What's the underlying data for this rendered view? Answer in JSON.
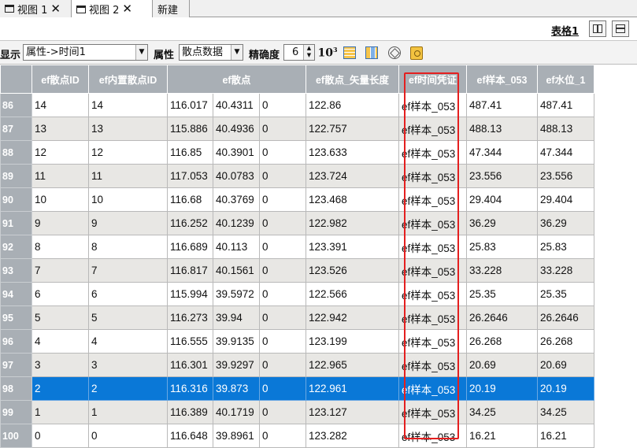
{
  "tabs": [
    {
      "label": "视图 1",
      "active": false
    },
    {
      "label": "视图 2",
      "active": true
    },
    {
      "label": "新建",
      "active": false
    }
  ],
  "sheet": {
    "label": "表格1"
  },
  "toolbar": {
    "display_label": "显示",
    "display_value": "属性->时间1",
    "attr_label": "属性",
    "attr_value": "散点数据",
    "precision_label": "精确度",
    "precision_value": "6",
    "pow_label": "10",
    "pow_sup": "3"
  },
  "table": {
    "headers": [
      "ef散点ID",
      "ef内置散点ID",
      "ef散点",
      "ef散点_矢量长度",
      "ef时间凭证",
      "ef样本_053",
      "ef水位_1"
    ],
    "rows": [
      {
        "n": "86",
        "c": [
          "14",
          "14",
          "116.017",
          "40.4311",
          "0",
          "122.86",
          "ef样本_053",
          "487.41",
          "487.41"
        ]
      },
      {
        "n": "87",
        "c": [
          "13",
          "13",
          "115.886",
          "40.4936",
          "0",
          "122.757",
          "ef样本_053",
          "488.13",
          "488.13"
        ]
      },
      {
        "n": "88",
        "c": [
          "12",
          "12",
          "116.85",
          "40.3901",
          "0",
          "123.633",
          "ef样本_053",
          "47.344",
          "47.344"
        ]
      },
      {
        "n": "89",
        "c": [
          "11",
          "11",
          "117.053",
          "40.0783",
          "0",
          "123.724",
          "ef样本_053",
          "23.556",
          "23.556"
        ]
      },
      {
        "n": "90",
        "c": [
          "10",
          "10",
          "116.68",
          "40.3769",
          "0",
          "123.468",
          "ef样本_053",
          "29.404",
          "29.404"
        ]
      },
      {
        "n": "91",
        "c": [
          "9",
          "9",
          "116.252",
          "40.1239",
          "0",
          "122.982",
          "ef样本_053",
          "36.29",
          "36.29"
        ]
      },
      {
        "n": "92",
        "c": [
          "8",
          "8",
          "116.689",
          "40.113",
          "0",
          "123.391",
          "ef样本_053",
          "25.83",
          "25.83"
        ]
      },
      {
        "n": "93",
        "c": [
          "7",
          "7",
          "116.817",
          "40.1561",
          "0",
          "123.526",
          "ef样本_053",
          "33.228",
          "33.228"
        ]
      },
      {
        "n": "94",
        "c": [
          "6",
          "6",
          "115.994",
          "39.5972",
          "0",
          "122.566",
          "ef样本_053",
          "25.35",
          "25.35"
        ]
      },
      {
        "n": "95",
        "c": [
          "5",
          "5",
          "116.273",
          "39.94",
          "0",
          "122.942",
          "ef样本_053",
          "26.2646",
          "26.2646"
        ]
      },
      {
        "n": "96",
        "c": [
          "4",
          "4",
          "116.555",
          "39.9135",
          "0",
          "123.199",
          "ef样本_053",
          "26.268",
          "26.268"
        ]
      },
      {
        "n": "97",
        "c": [
          "3",
          "3",
          "116.301",
          "39.9297",
          "0",
          "122.965",
          "ef样本_053",
          "20.69",
          "20.69"
        ]
      },
      {
        "n": "98",
        "c": [
          "2",
          "2",
          "116.316",
          "39.873",
          "0",
          "122.961",
          "ef样本_053",
          "20.19",
          "20.19"
        ],
        "selected": true
      },
      {
        "n": "99",
        "c": [
          "1",
          "1",
          "116.389",
          "40.1719",
          "0",
          "123.127",
          "ef样本_053",
          "34.25",
          "34.25"
        ]
      },
      {
        "n": "100",
        "c": [
          "0",
          "0",
          "116.648",
          "39.8961",
          "0",
          "123.282",
          "ef样本_053",
          "16.21",
          "16.21"
        ]
      }
    ]
  },
  "colors": {
    "selected_row": "#0a78d7",
    "highlight_box": "#e41f1f",
    "header_bg": "#a9afb5"
  }
}
